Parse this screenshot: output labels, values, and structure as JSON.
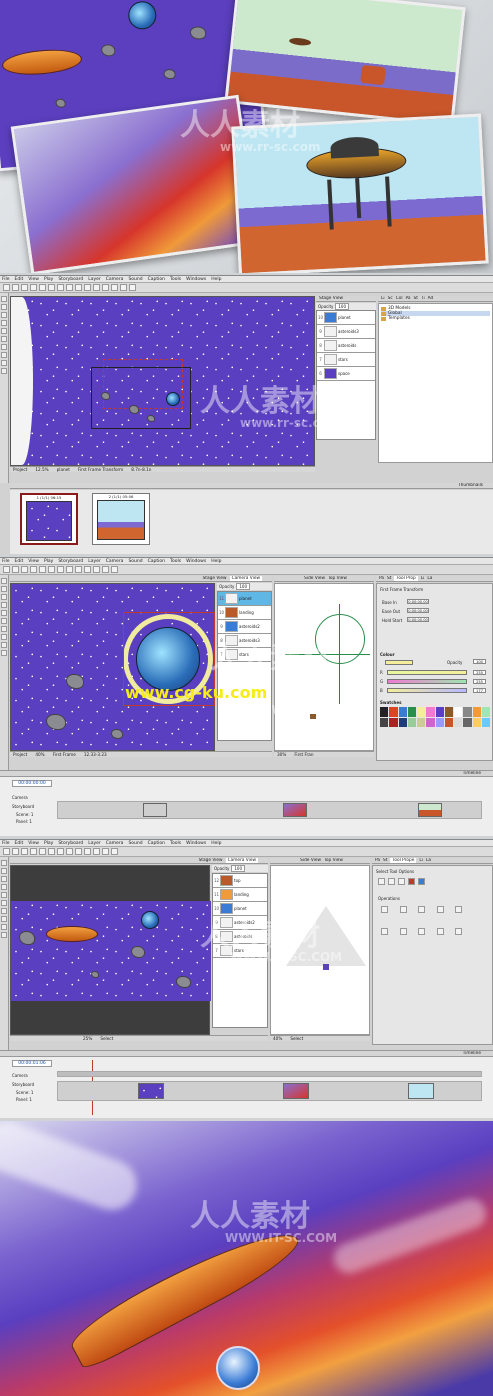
{
  "menu_items": [
    "File",
    "Edit",
    "View",
    "Play",
    "Storyboard",
    "Layer",
    "Camera",
    "Sound",
    "Caption",
    "Tools",
    "Windows",
    "Help"
  ],
  "menu_items_short": [
    "File",
    "Edit",
    "View",
    "Play",
    "Storyboard",
    "Layer",
    "Camera",
    "Sound",
    "Caption",
    "Tools",
    "Windows",
    "Help"
  ],
  "panel1": {
    "stage_view": "Stage View",
    "opacity_label": "Opacity",
    "opacity_value": "100",
    "layers": [
      "planet",
      "asteroids3",
      "asteroids",
      "stars",
      "space"
    ],
    "library_tabs": [
      "Li",
      "Sc",
      "Col",
      "Pa",
      "St",
      "Ti",
      "Ad"
    ],
    "library_tree": [
      "3D Models",
      "Global",
      "Templates"
    ],
    "status_project": "Project",
    "status_zoom": "12.5%",
    "status_layer": "planet",
    "status_mode": "First Frame Transform",
    "status_coords": "8.7n-8.1n",
    "thumbnails_title": "Thumbnails",
    "thumb1": "1 (1/1) 06:15",
    "thumb2": "2 (1/1) 05:06"
  },
  "panel2": {
    "tabs": [
      "Stage View",
      "Camera View",
      "Side View",
      "Top View"
    ],
    "right_tabs": [
      "Pa",
      "St",
      "Tool Prop",
      "Li",
      "La"
    ],
    "opacity_label": "Opacity",
    "opacity_value": "100",
    "layers": [
      "planet",
      "landing",
      "asteroids2",
      "asteroids3",
      "stars"
    ],
    "transform_title": "First Frame Transform",
    "base_in": "Base In",
    "ease_out": "Ease Out",
    "hold_start": "Hold Start",
    "time_values": [
      "0:00:00.00",
      "0:00:00.00",
      "0:00:00.00"
    ],
    "colour_title": "Colour",
    "rgb_labels": [
      "R",
      "G",
      "B"
    ],
    "rgb_values": [
      "255",
      "255",
      "177"
    ],
    "opacity2_label": "Opacity",
    "opacity2_value": "100",
    "swatches_title": "Swatches",
    "status_project": "Project",
    "status_zoom": "40%",
    "status_mode": "First Frame",
    "status_coords": "12.33-3.23",
    "status_zoom2": "30%",
    "status_mode2": "First Fran",
    "timeline_title": "Timeline",
    "timecode": "00:00:00:00",
    "track_camera": "Camera",
    "track_storyboard": "Storyboard",
    "scene_label": "Scene:",
    "scene_value": "1",
    "panel_label": "Panel:",
    "panel_value": "1"
  },
  "panel3": {
    "tabs": [
      "Stage View",
      "Camera View",
      "Side View",
      "Top View"
    ],
    "right_tabs": [
      "Pa",
      "St",
      "Tool Prope",
      "Li",
      "La"
    ],
    "opacity_label": "Opacity",
    "opacity_value": "100",
    "layers": [
      "top",
      "landing",
      "planet",
      "asteroids2",
      "asteroids",
      "stars"
    ],
    "tool_options_title": "Select Tool Options",
    "operations_label": "Operations",
    "status_zoom": "25%",
    "status_mode": "Select",
    "status_zoom2": "40%",
    "status_mode2": "Select",
    "timeline_title": "Timeline",
    "timecode": "00:00:01:06",
    "track_camera": "Camera",
    "track_storyboard": "Storyboard",
    "scene_label": "Scene:",
    "scene_value": "1",
    "panel_label": "Panel:",
    "panel_value": "1"
  },
  "watermarks": {
    "chinese": "人人素材",
    "site1": "www.rr-sc.com",
    "site2": "www.cg-ku.com",
    "site3": "WWW.IT-SC.COM"
  },
  "colors": {
    "space_purple": "#5a3fc0",
    "selection_red": "#c0392b",
    "accent_blue": "#3a7bd5",
    "colour_yellow": "#f4ee9a",
    "colour_green": "#9fe6b0",
    "colour_pink": "#f07ad0"
  }
}
